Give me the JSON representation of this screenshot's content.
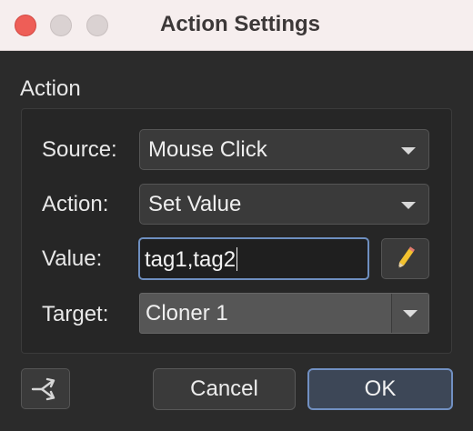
{
  "window": {
    "title": "Action Settings"
  },
  "section": {
    "label": "Action"
  },
  "rows": {
    "source": {
      "label": "Source:",
      "value": "Mouse Click"
    },
    "action": {
      "label": "Action:",
      "value": "Set Value"
    },
    "value": {
      "label": "Value:",
      "value": "tag1,tag2"
    },
    "target": {
      "label": "Target:",
      "value": "Cloner 1"
    }
  },
  "buttons": {
    "cancel": "Cancel",
    "ok": "OK"
  },
  "icons": {
    "edit": "pencil-icon",
    "connect": "branch-arrow-icon"
  },
  "colors": {
    "titlebar": "#f6eeee",
    "close": "#ee5e57",
    "focus_accent": "#7190c2",
    "pencil": "#f2c12e"
  }
}
